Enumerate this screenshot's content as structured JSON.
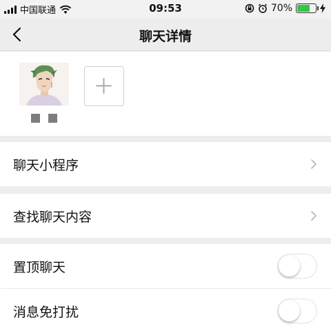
{
  "status_bar": {
    "carrier": "中国联通",
    "time": "09:53",
    "battery_percent": "70%",
    "battery_level": 0.7,
    "icons": [
      "signal-icon",
      "wifi-icon",
      "screen-lock-icon",
      "alarm-icon",
      "battery-icon",
      "charging-icon"
    ]
  },
  "nav": {
    "back_icon": "back-chevron-icon",
    "title": "聊天详情"
  },
  "members": {
    "add_icon": "plus-icon",
    "items": [
      {
        "avatar_icon": "anime-character-avatar"
      }
    ]
  },
  "cells": {
    "mini_programs": "聊天小程序",
    "search_history": "查找聊天内容",
    "pin_chat": "置顶聊天",
    "mute": "消息免打扰"
  },
  "toggles": {
    "pin_chat_on": false,
    "mute_on": false
  },
  "colors": {
    "background": "#ededed",
    "battery_green": "#34c44a",
    "toggle_off_border": "#e3e3e3"
  }
}
